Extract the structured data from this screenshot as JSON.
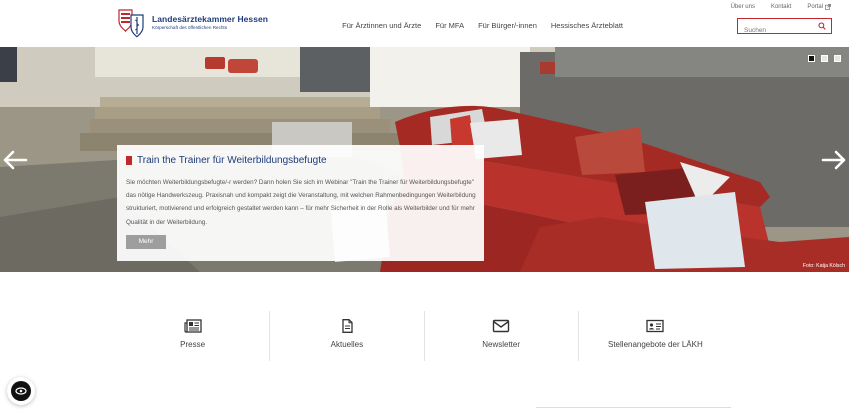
{
  "brand": {
    "name": "Landesärztekammer Hessen",
    "subtitle": "Körperschaft des öffentlichen Rechts",
    "primary_color": "#1f3c7a",
    "accent_color": "#c1272d"
  },
  "topnav": {
    "items": [
      {
        "label": "Über uns"
      },
      {
        "label": "Kontakt"
      },
      {
        "label": "Portal",
        "icon": "external-link-icon"
      }
    ]
  },
  "mainnav": {
    "items": [
      {
        "label": "Für Ärztinnen und Ärzte"
      },
      {
        "label": "Für MFA"
      },
      {
        "label": "Für Bürger/-innen"
      },
      {
        "label": "Hessisches Ärzteblatt"
      }
    ]
  },
  "search": {
    "placeholder": "Suchen",
    "icon": "search-icon"
  },
  "hero": {
    "slide_count": 3,
    "active_slide": 1,
    "credit": "Foto: Katja Kölsch",
    "caption_title": "Train the Trainer für Weiterbildungsbefugte",
    "caption_text": "Sie möchten Weiterbildungsbefugte/-r werden? Dann holen Sie sich im Webinar \"Train the Trainer für Weiterbildungsbefugte\" das nötige Handwerkszeug. Praxisnah und kompakt zeigt die Veranstaltung, mit welchen Rahmenbedingungen Weiterbildung strukturiert, motivierend und erfolgreich gestaltet werden kann – für mehr Sicherheit in der Rolle als Weiterbilder und für mehr Qualität in der Weiterbildung.",
    "more_label": "Mehr",
    "prev_icon": "arrow-left-icon",
    "next_icon": "arrow-right-icon"
  },
  "quicklinks": [
    {
      "label": "Presse",
      "icon": "newspaper-icon"
    },
    {
      "label": "Aktuelles",
      "icon": "document-icon"
    },
    {
      "label": "Newsletter",
      "icon": "envelope-icon"
    },
    {
      "label": "Stellenangebote der LÄKH",
      "icon": "id-card-icon"
    }
  ],
  "privacy_widget": {
    "icon": "privacy-eye-icon"
  }
}
